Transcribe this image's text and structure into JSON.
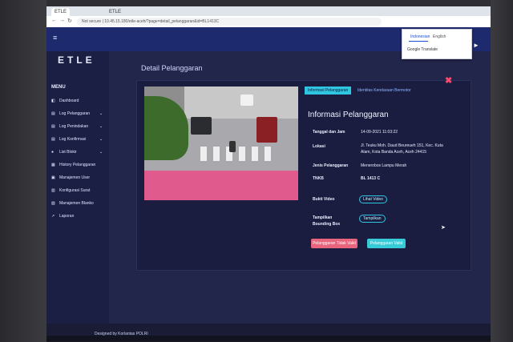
{
  "browser": {
    "tabs": [
      "ETLE",
      "ETLE"
    ],
    "address": "Not secure | 10.45.15.180/etle-aceh/?page=detail_pelanggaran&id=BL1413C"
  },
  "translate": {
    "lang_active": "Indonesian",
    "lang_other": "English",
    "option": "Google Translate"
  },
  "brand": "ETLE",
  "menu": {
    "title": "MENU",
    "items": [
      {
        "label": "Dashboard",
        "icon": "dashboard-icon",
        "chevron": false
      },
      {
        "label": "Log Pelanggaran",
        "icon": "log-icon",
        "chevron": true
      },
      {
        "label": "Log Penindakan",
        "icon": "log-icon",
        "chevron": true
      },
      {
        "label": "Log Konfirmasi",
        "icon": "log-icon",
        "chevron": true
      },
      {
        "label": "List Blokir",
        "icon": "list-icon",
        "chevron": true
      },
      {
        "label": "History Pelanggaran",
        "icon": "history-icon",
        "chevron": false
      },
      {
        "label": "Manajemen User",
        "icon": "user-icon",
        "chevron": false
      },
      {
        "label": "Konfigurasi Surat",
        "icon": "config-icon",
        "chevron": false
      },
      {
        "label": "Manajemen Blanko",
        "icon": "file-icon",
        "chevron": false
      },
      {
        "label": "Laporan",
        "icon": "chart-icon",
        "chevron": false
      }
    ]
  },
  "page_title": "Detail Pelanggaran",
  "detail_tabs": [
    "Informasi Pelanggaran",
    "Identitas Kendaraan Bermotor"
  ],
  "info": {
    "title": "Informasi Pelanggaran",
    "rows": [
      {
        "label": "Tanggal dan Jam",
        "value": "14-09-2021 11:03:22"
      },
      {
        "label": "Lokasi",
        "value": "Jl. Teuku Moh. Daud Beureueh 151, Kec. Kuta Alam, Kota Banda Aceh, Aceh 24415"
      },
      {
        "label": "Jenis Pelanggaran",
        "value": "Menerobos Lampu Merah"
      },
      {
        "label": "TNKB",
        "value": "BL 1413 C"
      }
    ],
    "bukti_label": "Bukti Video",
    "bukti_button": "Lihat Video",
    "bounding_label": "Tampilkan Bounding Box",
    "bounding_button": "Tampilkan"
  },
  "actions": {
    "invalid": "Pelanggaran Tidak Valid",
    "valid": "Pelanggaran Valid"
  },
  "footer": "Designed by Korlantas POLRI"
}
